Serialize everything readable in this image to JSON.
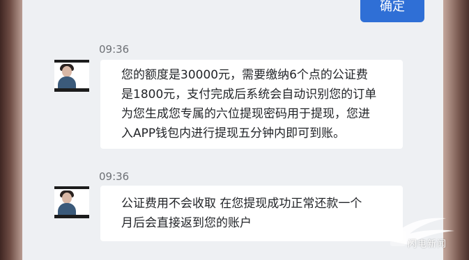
{
  "header": {
    "confirm_label": "确定"
  },
  "messages": [
    {
      "time": "09:36",
      "text": "您的额度是30000元，需要缴纳6个点的公证费\n是1800元，支付完成后系统会自动识别您的订单\n为您生成您专属的六位提现密码用于提现，您进\n入APP钱包内进行提现五分钟内即可到账。"
    },
    {
      "time": "09:36",
      "text": "公证费用不会收取 在您提现成功正常还款一个\n月后会直接返到您的账户"
    }
  ],
  "watermark": {
    "text": "闪电新闻",
    "color": "#ffffff"
  },
  "colors": {
    "accent": "#2f6fd6",
    "chat_background": "#eef0f3",
    "bubble": "#ffffff"
  }
}
